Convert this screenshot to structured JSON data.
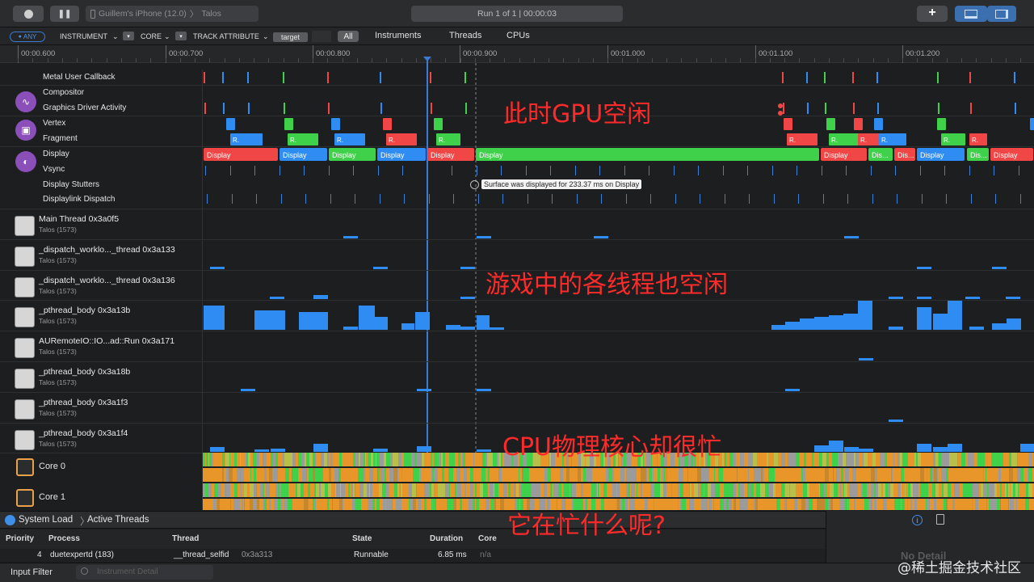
{
  "titlebar": {
    "device": "Guillem's iPhone (12.0)",
    "target": "Talos",
    "run_status": "Run 1 of 1  |  00:00:03",
    "add_label": "+"
  },
  "filterbar": {
    "any": "ANY",
    "instrument": "INSTRUMENT",
    "core": "CORE",
    "track_attribute": "TRACK ATTRIBUTE",
    "target": "target",
    "nav_all": "All",
    "nav_instruments": "Instruments",
    "nav_threads": "Threads",
    "nav_cpus": "CPUs"
  },
  "ruler": {
    "ticks": [
      "00:00.600",
      "00:00.700",
      "00:00.800",
      "00:00.900",
      "00:01.000",
      "00:01.100",
      "00:01.200"
    ]
  },
  "gpu_tracks": [
    "Metal User Callback",
    "Compositor",
    "Graphics Driver Activity",
    "Vertex",
    "Fragment",
    "Display",
    "Vsync",
    "Display Stutters",
    "Displaylink Dispatch"
  ],
  "display_segments": [
    "Display",
    "Display",
    "Display",
    "Display",
    "Display",
    "Display",
    "Display",
    "Dis...",
    "Dis...",
    "Display",
    "Dis...",
    "Display"
  ],
  "fragment_label": "R.",
  "tooltip": "Surface was displayed for 233.37 ms on Display",
  "threads": [
    {
      "name": "Main Thread  0x3a0f5",
      "process": "Talos (1573)"
    },
    {
      "name": "_dispatch_worklo..._thread  0x3a133",
      "process": "Talos (1573)"
    },
    {
      "name": "_dispatch_worklo..._thread  0x3a136",
      "process": "Talos (1573)"
    },
    {
      "name": "_pthread_body  0x3a13b",
      "process": "Talos (1573)"
    },
    {
      "name": "AURemoteIO::IO...ad::Run  0x3a171",
      "process": "Talos (1573)"
    },
    {
      "name": "_pthread_body  0x3a18b",
      "process": "Talos (1573)"
    },
    {
      "name": "_pthread_body  0x3a1f3",
      "process": "Talos (1573)"
    },
    {
      "name": "_pthread_body  0x3a1f4",
      "process": "Talos (1573)"
    }
  ],
  "cores": [
    "Core 0",
    "Core 1"
  ],
  "annotations": {
    "gpu_idle": "此时GPU空闲",
    "threads_idle": "游戏中的各线程也空闲",
    "cpu_busy": "CPU物理核心却很忙",
    "question": "它在忙什么呢?"
  },
  "detail": {
    "breadcrumb_root": "System Load",
    "breadcrumb_leaf": "Active Threads",
    "columns": [
      "Priority",
      "Process",
      "Thread",
      "State",
      "Duration",
      "Core"
    ],
    "row": {
      "priority": "4",
      "process": "duetexpertd (183)",
      "thread": "__thread_selfid",
      "thread_id": "0x3a313",
      "state": "Runnable",
      "duration": "6.85 ms",
      "core": "n/a"
    },
    "no_detail": "No Detail"
  },
  "footer": {
    "input_filter": "Input Filter",
    "instrument_detail_placeholder": "Instrument Detail"
  },
  "watermark": "@稀土掘金技术社区",
  "colors": {
    "red": "#f04646",
    "green": "#3fd14a",
    "blue": "#2f8cf2",
    "orange": "#e8952a",
    "annotation": "#ff2a2a"
  }
}
